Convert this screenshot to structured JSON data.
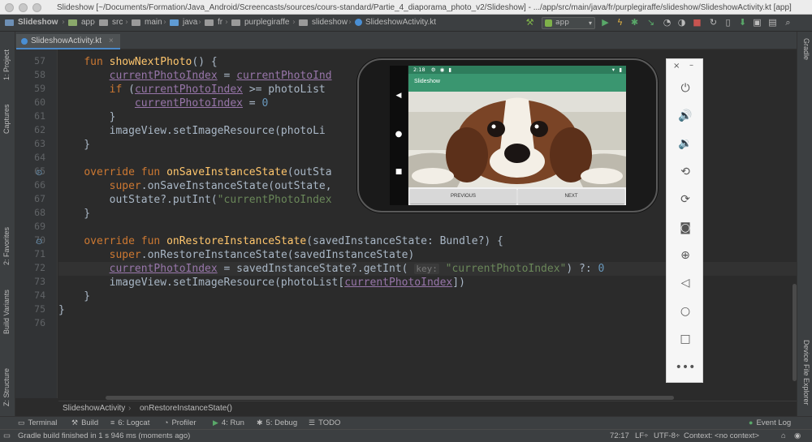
{
  "window": {
    "title": "Slideshow [~/Documents/Formation/Java_Android/Screencasts/sources/cours-standard/Partie_4_diaporama_photo_v2/Slideshow] - .../app/src/main/java/fr/purplegiraffe/slideshow/SlideshowActivity.kt [app]"
  },
  "nav": {
    "items": [
      "Slideshow",
      "app",
      "src",
      "main",
      "java",
      "fr",
      "purplegiraffe",
      "slideshow",
      "SlideshowActivity.kt"
    ],
    "run_config": "app"
  },
  "tabs": [
    {
      "label": "SlideshowActivity.kt"
    }
  ],
  "left_tools": {
    "project": "1: Project",
    "captures": "Captures",
    "favorites": "2: Favorites",
    "build_variants": "Build Variants",
    "structure": "Z: Structure"
  },
  "right_tools": {
    "gradle": "Gradle",
    "device_explorer": "Device File Explorer"
  },
  "editor": {
    "line_numbers": [
      "57",
      "58",
      "59",
      "60",
      "61",
      "62",
      "63",
      "64",
      "65",
      "66",
      "67",
      "68",
      "69",
      "70",
      "71",
      "72",
      "73",
      "74",
      "75",
      "76"
    ],
    "lines": [
      {
        "parts": [
          [
            "t",
            "    "
          ],
          [
            "kw",
            "fun "
          ],
          [
            "fn",
            "showNextPhoto"
          ],
          [
            "t",
            "() {"
          ]
        ]
      },
      {
        "parts": [
          [
            "t",
            "        "
          ],
          [
            "pv",
            "currentPhotoIndex"
          ],
          [
            "t",
            " = "
          ],
          [
            "pv",
            "currentPhotoInd"
          ]
        ]
      },
      {
        "parts": [
          [
            "t",
            "        "
          ],
          [
            "kw",
            "if "
          ],
          [
            "t",
            "("
          ],
          [
            "pv",
            "currentPhotoIndex"
          ],
          [
            "t",
            " >= photoList"
          ]
        ]
      },
      {
        "parts": [
          [
            "t",
            "            "
          ],
          [
            "pv",
            "currentPhotoIndex"
          ],
          [
            "t",
            " = "
          ],
          [
            "num",
            "0"
          ]
        ]
      },
      {
        "parts": [
          [
            "t",
            "        }"
          ]
        ]
      },
      {
        "parts": [
          [
            "t",
            "        imageView.setImageResource(photoLi"
          ]
        ]
      },
      {
        "parts": [
          [
            "t",
            "    }"
          ]
        ]
      },
      {
        "parts": [
          [
            "t",
            ""
          ]
        ]
      },
      {
        "parts": [
          [
            "t",
            "    "
          ],
          [
            "kw",
            "override fun "
          ],
          [
            "fn",
            "onSaveInstanceState"
          ],
          [
            "t",
            "(outSta"
          ]
        ]
      },
      {
        "parts": [
          [
            "t",
            "        "
          ],
          [
            "kw",
            "super"
          ],
          [
            "t",
            ".onSaveInstanceState(outState,"
          ]
        ]
      },
      {
        "parts": [
          [
            "t",
            "        outState?.putInt("
          ],
          [
            "str",
            "\"currentPhotoIndex"
          ]
        ]
      },
      {
        "parts": [
          [
            "t",
            "    }"
          ]
        ]
      },
      {
        "parts": [
          [
            "t",
            ""
          ]
        ]
      },
      {
        "parts": [
          [
            "t",
            "    "
          ],
          [
            "kw",
            "override fun "
          ],
          [
            "fn",
            "onRestoreInstanceState"
          ],
          [
            "t",
            "(savedInstanceState: Bundle?) {"
          ]
        ]
      },
      {
        "parts": [
          [
            "t",
            "        "
          ],
          [
            "kw",
            "super"
          ],
          [
            "t",
            ".onRestoreInstanceState(savedInstanceState)"
          ]
        ]
      },
      {
        "parts": [
          [
            "t",
            "        "
          ],
          [
            "pv",
            "currentPhotoIndex"
          ],
          [
            "t",
            " = savedInstanceState?.getInt( "
          ],
          [
            "hint",
            "key:"
          ],
          [
            "t",
            " "
          ],
          [
            "str",
            "\"currentPhotoIndex\""
          ],
          [
            "t",
            ") ?: "
          ],
          [
            "num",
            "0"
          ]
        ]
      },
      {
        "parts": [
          [
            "t",
            "        imageView.setImageResource(photoList["
          ],
          [
            "pv",
            "currentPhotoIndex"
          ],
          [
            "t",
            "])"
          ]
        ]
      },
      {
        "parts": [
          [
            "t",
            "    }"
          ]
        ]
      },
      {
        "parts": [
          [
            "t",
            "}"
          ]
        ]
      },
      {
        "parts": [
          [
            "t",
            ""
          ]
        ]
      }
    ]
  },
  "breadcrumb": {
    "class_name": "SlideshowActivity",
    "method_name": "onRestoreInstanceState()"
  },
  "toolwindows": {
    "terminal": "Terminal",
    "build": "Build",
    "logcat": "6: Logcat",
    "profiler": "Profiler",
    "run": "4: Run",
    "debug": "5: Debug",
    "todo": "TODO",
    "event_log": "Event Log"
  },
  "status": {
    "message": "Gradle build finished in 1 s 946 ms (moments ago)",
    "position": "72:17",
    "line_sep": "LF÷",
    "encoding": "UTF-8÷",
    "context": "Context: <no context>"
  },
  "emulator": {
    "time": "2:18",
    "app_title": "Slideshow",
    "previous_label": "PREVIOUS",
    "next_label": "NEXT"
  },
  "colors": {
    "keyword": "#cc7832",
    "function": "#ffc66d",
    "property": "#9876aa",
    "string": "#6a8759",
    "number": "#6897bb",
    "app_bar": "#3a9670"
  }
}
